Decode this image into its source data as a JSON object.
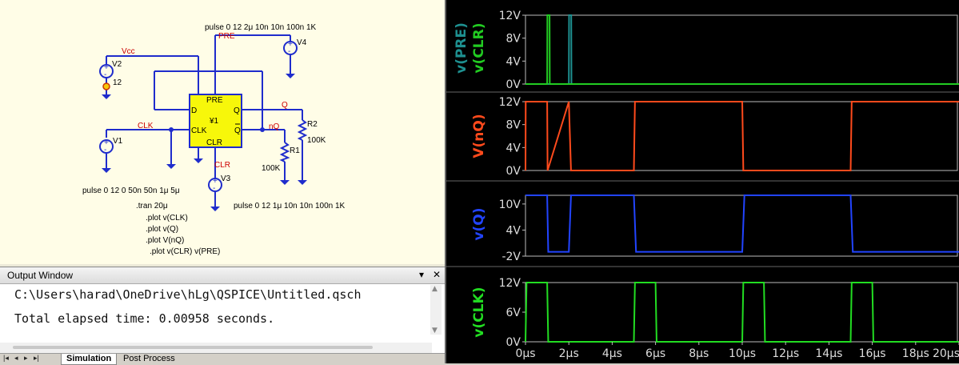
{
  "schematic": {
    "labels": {
      "pulse_top": "pulse 0 12 2μ 10n 10n 100n 1K",
      "pre_net": "PRE",
      "v4": "V4",
      "vcc_net": "Vcc",
      "v2": "V2",
      "v2_value": "12",
      "pre_pin": "PRE",
      "d_pin": "D",
      "q_pin": "Q",
      "q_net": "Q",
      "y1": "¥1",
      "clk_pin": "CLK",
      "nq_pin": "Q",
      "nq_net": "nQ",
      "clr_pin": "CLR",
      "clk_net": "CLK",
      "v1": "V1",
      "r2": "R2",
      "r2_value": "100K",
      "r1": "R1",
      "r1_value": "100K",
      "clr_net": "CLR",
      "v3": "V3",
      "pulse_v1": "pulse 0 12 0 50n 50n 1μ 5μ",
      "pulse_v3": "pulse 0 12 1μ 10n 10n 100n 1K",
      "tran": ".tran 20μ",
      "plot1": ".plot v(CLK)",
      "plot2": ".plot v(Q)",
      "plot3": ".plot V(nQ)",
      "plot4": ".plot v(CLR) v(PRE)"
    }
  },
  "output_window": {
    "title": "Output Window",
    "lines": [
      "C:\\Users\\harad\\OneDrive\\hLg\\QSPICE\\Untitled.qsch",
      "Total elapsed time: 0.00958 seconds."
    ]
  },
  "tabs": [
    {
      "label": "Simulation",
      "active": true
    },
    {
      "label": "Post Process",
      "active": false
    }
  ],
  "colors": {
    "pre": "#1e9090",
    "clr": "#22cc22",
    "nq": "#ff4a1c",
    "q": "#2244ff",
    "clk": "#22dd22",
    "wire": "#1f2ccc",
    "net_label": "#cc0000",
    "component": "#f7f70a"
  },
  "chart_data": [
    {
      "type": "line",
      "x_unit": "μs",
      "xlim": [
        0,
        20
      ],
      "ylim": [
        0,
        12
      ],
      "ticks": [
        "12V",
        "8V",
        "4V",
        "0V"
      ],
      "tick_values": [
        12,
        8,
        4,
        0
      ],
      "series": [
        {
          "name": "v(PRE)",
          "x": [
            0,
            2.0,
            2.01,
            2.11,
            2.12,
            20
          ],
          "y": [
            0,
            0,
            12,
            12,
            0,
            0
          ]
        },
        {
          "name": "v(CLR)",
          "x": [
            0,
            1.0,
            1.01,
            1.11,
            1.12,
            20
          ],
          "y": [
            0,
            0,
            12,
            12,
            0,
            0
          ]
        }
      ]
    },
    {
      "type": "line",
      "x_unit": "μs",
      "xlim": [
        0,
        20
      ],
      "ylim": [
        0,
        12
      ],
      "ticks": [
        "12V",
        "8V",
        "4V",
        "0V"
      ],
      "tick_values": [
        12,
        8,
        4,
        0
      ],
      "series": [
        {
          "name": "V(nQ)",
          "x": [
            0,
            0.01,
            1.0,
            1.02,
            2.0,
            2.1,
            5.0,
            5.05,
            10.0,
            10.05,
            15.0,
            15.05,
            20
          ],
          "y": [
            0,
            12,
            12,
            0,
            12,
            0,
            0,
            12,
            12,
            0,
            0,
            12,
            12
          ]
        }
      ]
    },
    {
      "type": "line",
      "x_unit": "μs",
      "xlim": [
        0,
        20
      ],
      "ylim": [
        -2,
        12
      ],
      "ticks": [
        "10V",
        "4V",
        "-2V"
      ],
      "tick_values": [
        10,
        4,
        -2
      ],
      "series": [
        {
          "name": "v(Q)",
          "x": [
            0,
            1.0,
            1.05,
            2.0,
            2.1,
            5.0,
            5.1,
            10.0,
            10.1,
            15.0,
            15.1,
            20
          ],
          "y": [
            12,
            12,
            -1,
            -1,
            12,
            12,
            -1,
            -1,
            12,
            12,
            -1,
            -1
          ]
        }
      ]
    },
    {
      "type": "line",
      "x_unit": "μs",
      "xlim": [
        0,
        20
      ],
      "ylim": [
        0,
        12
      ],
      "ticks": [
        "12V",
        "6V",
        "0V"
      ],
      "tick_values": [
        12,
        6,
        0
      ],
      "x_ticks": [
        "0μs",
        "2μs",
        "4μs",
        "6μs",
        "8μs",
        "10μs",
        "12μs",
        "14μs",
        "16μs",
        "18μs",
        "20μs"
      ],
      "x_tick_values": [
        0,
        2,
        4,
        6,
        8,
        10,
        12,
        14,
        16,
        18,
        20
      ],
      "series": [
        {
          "name": "v(CLK)",
          "x": [
            0,
            0.05,
            1.0,
            1.05,
            1.1,
            5.0,
            5.05,
            6.0,
            6.05,
            10.0,
            10.05,
            11.0,
            11.05,
            15.0,
            15.05,
            16.0,
            16.05,
            20
          ],
          "y": [
            0,
            12,
            12,
            0,
            0,
            0,
            12,
            12,
            0,
            0,
            12,
            12,
            0,
            0,
            12,
            12,
            0,
            0
          ]
        }
      ]
    }
  ]
}
